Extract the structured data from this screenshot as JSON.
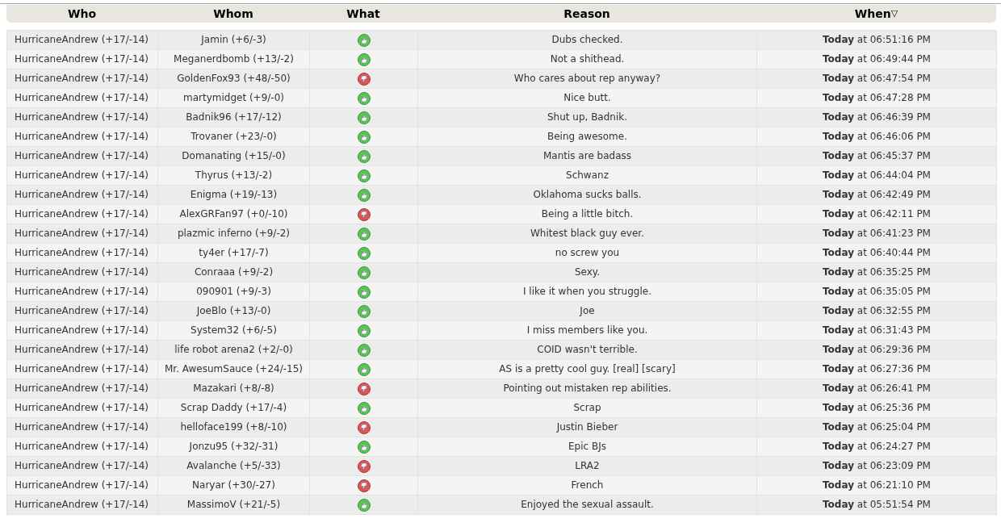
{
  "columns": [
    {
      "label": "Who"
    },
    {
      "label": "Whom"
    },
    {
      "label": "What"
    },
    {
      "label": "Reason"
    },
    {
      "label": "When",
      "sort_indicator": "▽"
    }
  ],
  "rows": [
    {
      "who": "HurricaneAndrew (+17/-14)",
      "whom": "Jamin (+6/-3)",
      "kind": "positive",
      "reason": "Dubs checked.",
      "when": "**Today** at 06:51:16 PM"
    },
    {
      "who": "HurricaneAndrew (+17/-14)",
      "whom": "Meganerdbomb (+13/-2)",
      "kind": "positive",
      "reason": "Not a shithead.",
      "when": "**Today** at 06:49:44 PM"
    },
    {
      "who": "HurricaneAndrew (+17/-14)",
      "whom": "GoldenFox93 (+48/-50)",
      "kind": "negative",
      "reason": "Who cares about rep anyway?",
      "when": "**Today** at 06:47:54 PM"
    },
    {
      "who": "HurricaneAndrew (+17/-14)",
      "whom": "martymidget (+9/-0)",
      "kind": "positive",
      "reason": "Nice butt.",
      "when": "**Today** at 06:47:28 PM"
    },
    {
      "who": "HurricaneAndrew (+17/-14)",
      "whom": "Badnik96 (+17/-12)",
      "kind": "positive",
      "reason": "Shut up, Badnik.",
      "when": "**Today** at 06:46:39 PM"
    },
    {
      "who": "HurricaneAndrew (+17/-14)",
      "whom": "Trovaner (+23/-0)",
      "kind": "positive",
      "reason": "Being awesome.",
      "when": "**Today** at 06:46:06 PM"
    },
    {
      "who": "HurricaneAndrew (+17/-14)",
      "whom": "Domanating (+15/-0)",
      "kind": "positive",
      "reason": "Mantis are badass",
      "when": "**Today** at 06:45:37 PM"
    },
    {
      "who": "HurricaneAndrew (+17/-14)",
      "whom": "Thyrus (+13/-2)",
      "kind": "positive",
      "reason": "Schwanz",
      "when": "**Today** at 06:44:04 PM"
    },
    {
      "who": "HurricaneAndrew (+17/-14)",
      "whom": "Enigma (+19/-13)",
      "kind": "positive",
      "reason": "Oklahoma sucks balls.",
      "when": "**Today** at 06:42:49 PM"
    },
    {
      "who": "HurricaneAndrew (+17/-14)",
      "whom": "AlexGRFan97 (+0/-10)",
      "kind": "negative",
      "reason": "Being a little bitch.",
      "when": "**Today** at 06:42:11 PM"
    },
    {
      "who": "HurricaneAndrew (+17/-14)",
      "whom": "plazmic inferno (+9/-2)",
      "kind": "positive",
      "reason": "Whitest black guy ever.",
      "when": "**Today** at 06:41:23 PM"
    },
    {
      "who": "HurricaneAndrew (+17/-14)",
      "whom": "ty4er (+17/-7)",
      "kind": "positive",
      "reason": "no screw you",
      "when": "**Today** at 06:40:44 PM"
    },
    {
      "who": "HurricaneAndrew (+17/-14)",
      "whom": "Conraaa (+9/-2)",
      "kind": "positive",
      "reason": "Sexy.",
      "when": "**Today** at 06:35:25 PM"
    },
    {
      "who": "HurricaneAndrew (+17/-14)",
      "whom": "090901 (+9/-3)",
      "kind": "positive",
      "reason": "I like it when you struggle.",
      "when": "**Today** at 06:35:05 PM"
    },
    {
      "who": "HurricaneAndrew (+17/-14)",
      "whom": "JoeBlo (+13/-0)",
      "kind": "positive",
      "reason": "Joe",
      "when": "**Today** at 06:32:55 PM"
    },
    {
      "who": "HurricaneAndrew (+17/-14)",
      "whom": "System32 (+6/-5)",
      "kind": "positive",
      "reason": "I miss members like you.",
      "when": "**Today** at 06:31:43 PM"
    },
    {
      "who": "HurricaneAndrew (+17/-14)",
      "whom": "life robot arena2 (+2/-0)",
      "kind": "positive",
      "reason": "COID wasn't terrible.",
      "when": "**Today** at 06:29:36 PM"
    },
    {
      "who": "HurricaneAndrew (+17/-14)",
      "whom": "Mr. AwesumSauce (+24/-15)",
      "kind": "positive",
      "reason": "AS is a pretty cool guy. [real] [scary]",
      "when": "**Today** at 06:27:36 PM"
    },
    {
      "who": "HurricaneAndrew (+17/-14)",
      "whom": "Mazakari (+8/-8)",
      "kind": "negative",
      "reason": "Pointing out mistaken rep abilities.",
      "when": "**Today** at 06:26:41 PM"
    },
    {
      "who": "HurricaneAndrew (+17/-14)",
      "whom": "Scrap Daddy (+17/-4)",
      "kind": "positive",
      "reason": "Scrap",
      "when": "**Today** at 06:25:36 PM"
    },
    {
      "who": "HurricaneAndrew (+17/-14)",
      "whom": "helloface199 (+8/-10)",
      "kind": "negative",
      "reason": "Justin Bieber",
      "when": "**Today** at 06:25:04 PM"
    },
    {
      "who": "HurricaneAndrew (+17/-14)",
      "whom": "Jonzu95 (+32/-31)",
      "kind": "positive",
      "reason": "Epic BJs",
      "when": "**Today** at 06:24:27 PM"
    },
    {
      "who": "HurricaneAndrew (+17/-14)",
      "whom": "Avalanche (+5/-33)",
      "kind": "negative",
      "reason": "LRA2",
      "when": "**Today** at 06:23:09 PM"
    },
    {
      "who": "HurricaneAndrew (+17/-14)",
      "whom": "Naryar (+30/-27)",
      "kind": "negative",
      "reason": "French",
      "when": "**Today** at 06:21:10 PM"
    },
    {
      "who": "HurricaneAndrew (+17/-14)",
      "whom": "MassimoV (+21/-5)",
      "kind": "positive",
      "reason": "Enjoyed the sexual assault.",
      "when": "**Today** at 05:51:54 PM"
    }
  ]
}
